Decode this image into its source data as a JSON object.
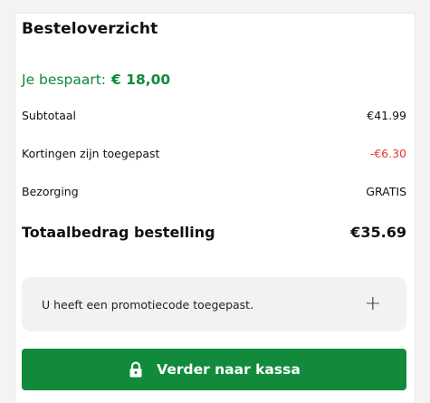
{
  "order_summary": {
    "title": "Besteloverzicht",
    "savings_label": "Je bespaart:",
    "savings_amount": "€ 18,00",
    "rows": [
      {
        "label": "Subtotaal",
        "value": "€41.99"
      },
      {
        "label": "Kortingen zijn toegepast",
        "value": "-€6.30"
      },
      {
        "label": "Bezorging",
        "value": "GRATIS"
      }
    ],
    "total_label": "Totaalbedrag bestelling",
    "total_value": "€35.69",
    "promo_text": "U heeft een promotiecode toegepast.",
    "promo_toggle": "+",
    "checkout_label": "Verder naar kassa"
  },
  "colors": {
    "accent_green": "#118a3c",
    "savings_green": "#0d8a3d",
    "discount_red": "#e53935"
  },
  "icons": {
    "checkout": "lock-icon",
    "promo": "plus-icon"
  }
}
